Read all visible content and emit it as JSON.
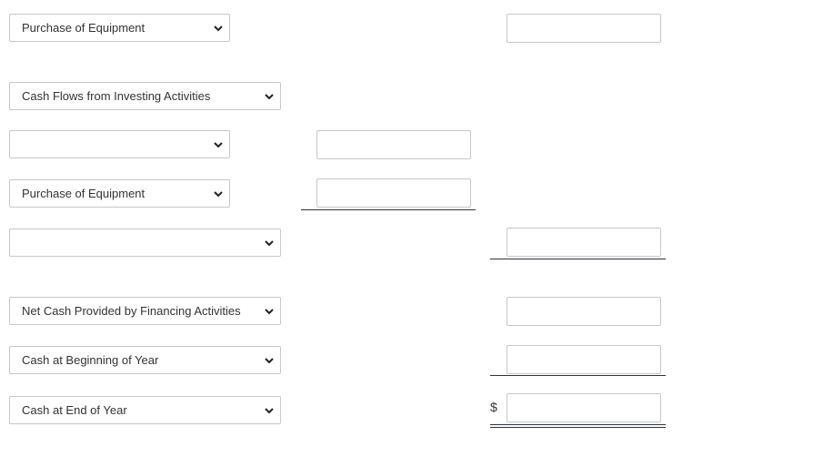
{
  "rows": [
    {
      "select": "Purchase of Equipment"
    },
    {
      "select": "Cash Flows from Investing Activities"
    },
    {
      "select": ""
    },
    {
      "select": "Purchase of Equipment"
    },
    {
      "select": ""
    },
    {
      "select": "Net Cash Provided by Financing Activities"
    },
    {
      "select": "Cash at Beginning of Year"
    },
    {
      "select": "Cash at End of Year"
    }
  ],
  "currency_symbol": "$",
  "icons": {
    "dropdown": "chevron-down-icon"
  }
}
